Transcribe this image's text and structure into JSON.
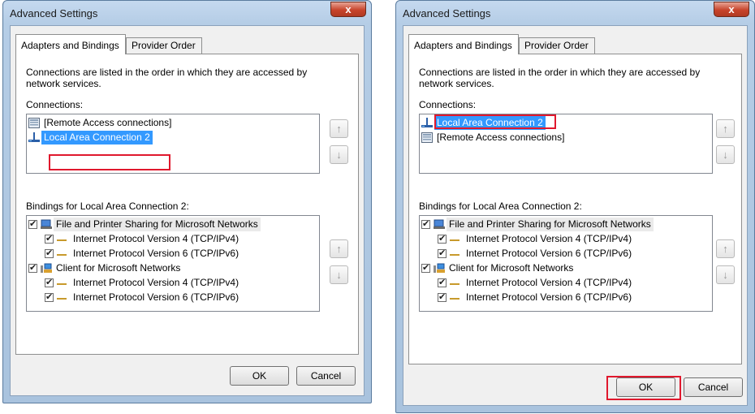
{
  "dialog": {
    "title": "Advanced Settings",
    "close_label": "x",
    "tabs": [
      {
        "label": "Adapters and Bindings",
        "active": true
      },
      {
        "label": "Provider Order",
        "active": false
      }
    ],
    "description": "Connections are listed in the order in which they are accessed by network services.",
    "connections_label": "Connections:",
    "bindings_label": "Bindings for Local Area Connection 2:",
    "ok_label": "OK",
    "cancel_label": "Cancel",
    "move_up_icon": "up-arrow-icon",
    "move_down_icon": "down-arrow-icon"
  },
  "before": {
    "connections": [
      {
        "label": "[Remote Access connections]",
        "icon": "remote-access-icon",
        "selected": false
      },
      {
        "label": "Local Area Connection 2",
        "icon": "network-adapter-icon",
        "selected": true
      }
    ]
  },
  "after": {
    "connections": [
      {
        "label": "Local Area Connection 2",
        "icon": "network-adapter-icon",
        "selected": true
      },
      {
        "label": "[Remote Access connections]",
        "icon": "remote-access-icon",
        "selected": false
      }
    ]
  },
  "bindings": [
    {
      "label": "File and Printer Sharing for Microsoft Networks",
      "level": 0,
      "checked": true,
      "icon": "file-printer-sharing-icon"
    },
    {
      "label": "Internet Protocol Version 4 (TCP/IPv4)",
      "level": 1,
      "checked": true,
      "icon": "protocol-icon"
    },
    {
      "label": "Internet Protocol Version 6 (TCP/IPv6)",
      "level": 1,
      "checked": true,
      "icon": "protocol-icon"
    },
    {
      "label": "Client for Microsoft Networks",
      "level": 0,
      "checked": true,
      "icon": "client-networks-icon"
    },
    {
      "label": "Internet Protocol Version 4 (TCP/IPv4)",
      "level": 1,
      "checked": true,
      "icon": "protocol-icon"
    },
    {
      "label": "Internet Protocol Version 6 (TCP/IPv6)",
      "level": 1,
      "checked": true,
      "icon": "protocol-icon"
    }
  ],
  "colors": {
    "selection": "#3399ff",
    "highlight_box": "#e0182d"
  }
}
